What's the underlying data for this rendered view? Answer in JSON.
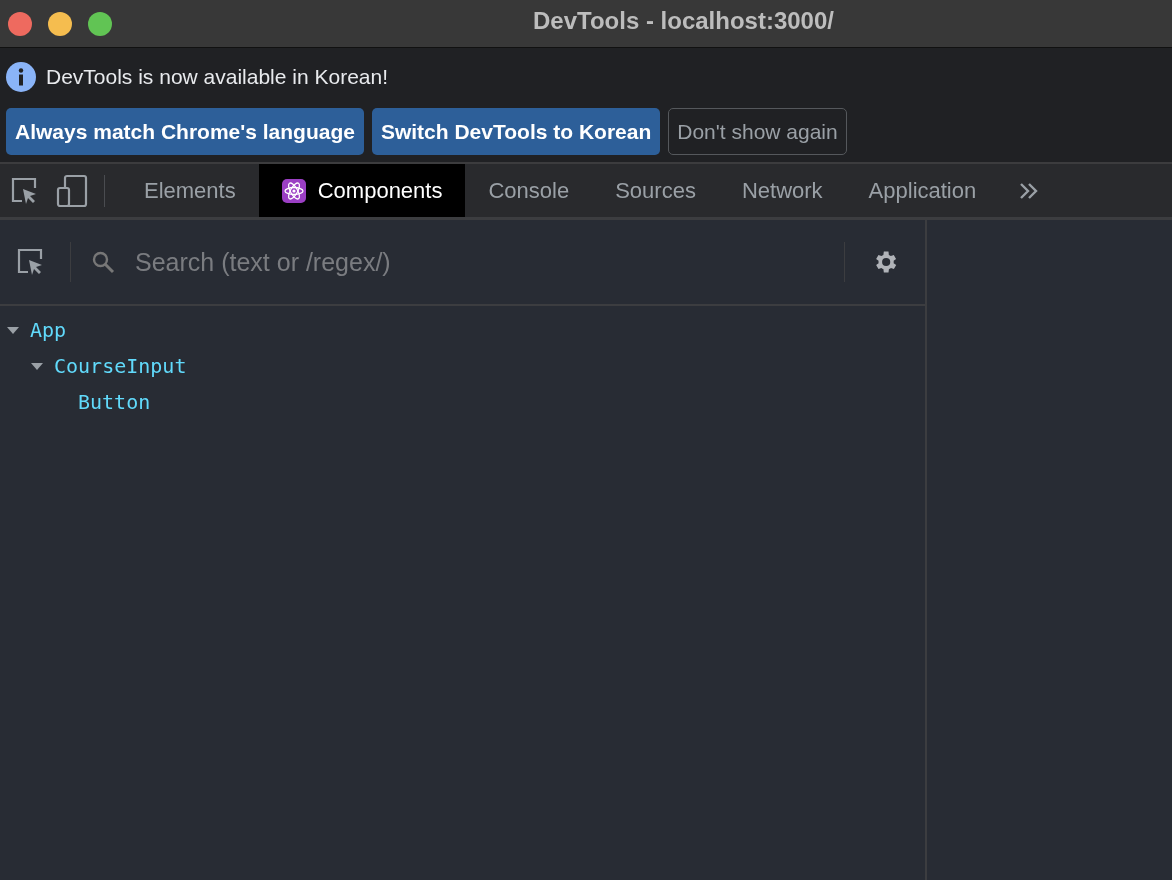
{
  "window": {
    "title": "DevTools - localhost:3000/"
  },
  "infobar": {
    "message": "DevTools is now available in Korean!",
    "buttons": [
      {
        "label": "Always match Chrome's language",
        "kind": "primary"
      },
      {
        "label": "Switch DevTools to Korean",
        "kind": "primary"
      },
      {
        "label": "Don't show again",
        "kind": "secondary"
      }
    ]
  },
  "tabs": [
    {
      "label": "Elements",
      "selected": false
    },
    {
      "label": "Components",
      "selected": true,
      "kind": "react"
    },
    {
      "label": "Console",
      "selected": false
    },
    {
      "label": "Sources",
      "selected": false
    },
    {
      "label": "Network",
      "selected": false
    },
    {
      "label": "Application",
      "selected": false
    }
  ],
  "search": {
    "placeholder": "Search (text or /regex/)"
  },
  "tree": [
    {
      "name": "App",
      "expanded": true,
      "children": [
        {
          "name": "CourseInput",
          "expanded": true,
          "children": [
            {
              "name": "Button"
            }
          ]
        }
      ]
    }
  ]
}
